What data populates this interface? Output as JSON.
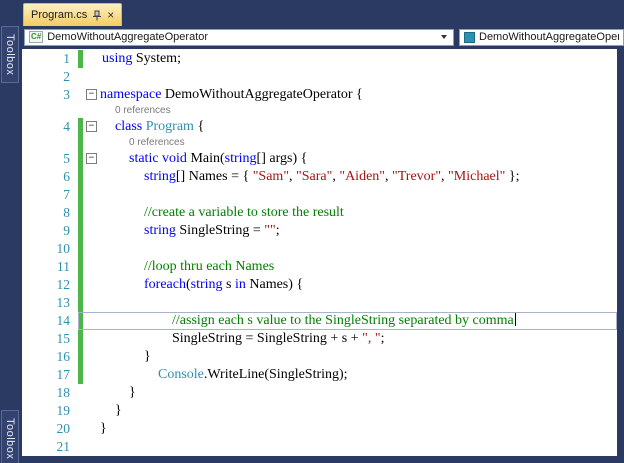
{
  "chrome": {
    "document_tab": "Program.cs",
    "side_tab_top": "Toolbox",
    "side_tab_bottom": "Toolbox",
    "navbar_left": "DemoWithoutAggregateOperator",
    "navbar_right": "DemoWithoutAggregateOperato",
    "close_glyph": "×",
    "csharp_badge": "C#"
  },
  "colors": {
    "chrome_bg": "#2b3a62",
    "tab_top": "#fdf1c3",
    "tab_bottom": "#f3cb60",
    "editor_bg": "#ffffff",
    "line_number": "#2b91af",
    "change_bar": "#4cb648",
    "codelens": "#7a7a7a",
    "current_line_border": "#a8b3c8",
    "tokens": {
      "kw": "#0000ff",
      "ty": "#2b91af",
      "st": "#a31515",
      "cm": "#008000",
      "pl": "#000000"
    }
  },
  "editor": {
    "codelens_label": "0 references",
    "fold_glyph": "−",
    "rows": [
      {
        "n": 1,
        "ind": 2,
        "chg": true,
        "segs": [
          [
            "kw",
            "using"
          ],
          [
            "pl",
            " System;"
          ]
        ]
      },
      {
        "n": 2,
        "ind": 0,
        "segs": []
      },
      {
        "n": 3,
        "ind": 0,
        "fold": true,
        "segs": [
          [
            "kw",
            "namespace"
          ],
          [
            "pl",
            " DemoWithoutAggregateOperator {"
          ]
        ]
      },
      {
        "lens": true,
        "ind": 15
      },
      {
        "n": 4,
        "ind": 15,
        "fold": true,
        "chg": true,
        "segs": [
          [
            "kw",
            "class"
          ],
          [
            "ty",
            " Program"
          ],
          [
            "pl",
            " {"
          ]
        ]
      },
      {
        "lens": true,
        "ind": 29,
        "chg": true
      },
      {
        "n": 5,
        "ind": 29,
        "fold": true,
        "chg": true,
        "segs": [
          [
            "kw",
            "static"
          ],
          [
            "pl",
            " "
          ],
          [
            "kw",
            "void"
          ],
          [
            "pl",
            " Main("
          ],
          [
            "kw",
            "string"
          ],
          [
            "pl",
            "[] args) {"
          ]
        ]
      },
      {
        "n": 6,
        "ind": 44,
        "chg": true,
        "segs": [
          [
            "kw",
            "string"
          ],
          [
            "pl",
            "[] Names = { "
          ],
          [
            "st",
            "\"Sam\""
          ],
          [
            "pl",
            ", "
          ],
          [
            "st",
            "\"Sara\""
          ],
          [
            "pl",
            ", "
          ],
          [
            "st",
            "\"Aiden\""
          ],
          [
            "pl",
            ", "
          ],
          [
            "st",
            "\"Trevor\""
          ],
          [
            "pl",
            ", "
          ],
          [
            "st",
            "\"Michael\""
          ],
          [
            "pl",
            " };"
          ]
        ]
      },
      {
        "n": 7,
        "ind": 0,
        "chg": true,
        "segs": []
      },
      {
        "n": 8,
        "ind": 44,
        "chg": true,
        "segs": [
          [
            "cm",
            "//create a variable to store the result"
          ]
        ]
      },
      {
        "n": 9,
        "ind": 44,
        "chg": true,
        "segs": [
          [
            "kw",
            "string"
          ],
          [
            "pl",
            " SingleString = "
          ],
          [
            "st",
            "\"\""
          ],
          [
            "pl",
            ";"
          ]
        ]
      },
      {
        "n": 10,
        "ind": 0,
        "chg": true,
        "segs": []
      },
      {
        "n": 11,
        "ind": 44,
        "chg": true,
        "segs": [
          [
            "cm",
            "//loop thru each Names"
          ]
        ]
      },
      {
        "n": 12,
        "ind": 44,
        "chg": true,
        "segs": [
          [
            "kw",
            "foreach"
          ],
          [
            "pl",
            "("
          ],
          [
            "kw",
            "string"
          ],
          [
            "pl",
            " s "
          ],
          [
            "kw",
            "in"
          ],
          [
            "pl",
            " Names) {"
          ]
        ]
      },
      {
        "n": 13,
        "ind": 0,
        "chg": true,
        "segs": []
      },
      {
        "n": 14,
        "ind": 72,
        "chg": true,
        "cur": true,
        "caret": true,
        "segs": [
          [
            "cm",
            "//assign each s value to the SingleString separated by comma"
          ]
        ]
      },
      {
        "n": 15,
        "ind": 72,
        "chg": true,
        "segs": [
          [
            "pl",
            "SingleString = SingleString + s + "
          ],
          [
            "st",
            "\", \""
          ],
          [
            "pl",
            ";"
          ]
        ]
      },
      {
        "n": 16,
        "ind": 44,
        "chg": true,
        "segs": [
          [
            "pl",
            "}"
          ]
        ]
      },
      {
        "n": 17,
        "ind": 58,
        "chg": true,
        "segs": [
          [
            "ty",
            "Console"
          ],
          [
            "pl",
            ".WriteLine(SingleString);"
          ]
        ]
      },
      {
        "n": 18,
        "ind": 29,
        "segs": [
          [
            "pl",
            "}"
          ]
        ]
      },
      {
        "n": 19,
        "ind": 15,
        "segs": [
          [
            "pl",
            "}"
          ]
        ]
      },
      {
        "n": 20,
        "ind": 0,
        "segs": [
          [
            "pl",
            "}"
          ]
        ]
      },
      {
        "n": 21,
        "ind": 0,
        "segs": []
      }
    ]
  }
}
